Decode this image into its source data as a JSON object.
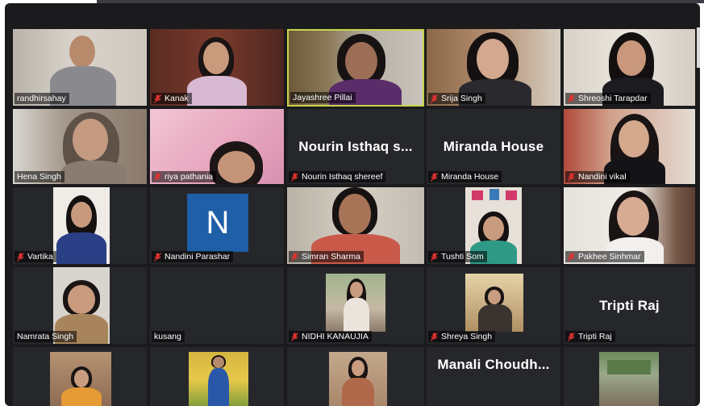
{
  "meeting": {
    "participants": [
      {
        "name": "randhirsahay",
        "muted": false,
        "video": true,
        "active": false
      },
      {
        "name": "Kanak",
        "muted": true,
        "video": true,
        "active": false
      },
      {
        "name": "Jayashree Pillai",
        "muted": false,
        "video": true,
        "active": true
      },
      {
        "name": "Srija Singh",
        "muted": true,
        "video": true,
        "active": false
      },
      {
        "name": "Shreoshi Tarapdar",
        "muted": true,
        "video": true,
        "active": false
      },
      {
        "name": "Hena Singh",
        "muted": false,
        "video": true,
        "active": false
      },
      {
        "name": "riya pathania",
        "muted": true,
        "video": true,
        "active": false
      },
      {
        "name": "Nourin Isthaq shereef",
        "display_name": "Nourin Isthaq s...",
        "muted": true,
        "video": false,
        "active": false
      },
      {
        "name": "Miranda House",
        "display_name": "Miranda House",
        "muted": true,
        "video": false,
        "active": false
      },
      {
        "name": "Nandini vikal",
        "muted": true,
        "video": true,
        "active": false
      },
      {
        "name": "Vartika",
        "muted": true,
        "video": true,
        "active": false
      },
      {
        "name": "Nandini Parashar",
        "avatar_letter": "N",
        "muted": true,
        "video": false,
        "active": false
      },
      {
        "name": "Simran Sharma",
        "muted": true,
        "video": true,
        "active": false
      },
      {
        "name": "Tushti Som",
        "muted": true,
        "video": true,
        "active": false
      },
      {
        "name": "Pakhee Sinhmar",
        "muted": true,
        "video": true,
        "active": false
      },
      {
        "name": "Namrata Singh",
        "muted": false,
        "video": true,
        "active": false
      },
      {
        "name": "kusang",
        "muted": false,
        "video": false,
        "active": false
      },
      {
        "name": "NIDHI KANAUJIA",
        "muted": true,
        "video": true,
        "active": false
      },
      {
        "name": "Shreya Singh",
        "muted": true,
        "video": true,
        "active": false
      },
      {
        "name": "Tripti Raj",
        "display_name": "Tripti Raj",
        "muted": true,
        "video": false,
        "active": false
      },
      {
        "name": "",
        "muted": false,
        "video": true,
        "active": false
      },
      {
        "name": "",
        "muted": false,
        "video": true,
        "active": false
      },
      {
        "name": "",
        "muted": false,
        "video": true,
        "active": false
      },
      {
        "name": "Manali Choudhary",
        "display_name": "Manali Choudh...",
        "muted": false,
        "video": false,
        "active": false
      },
      {
        "name": "",
        "muted": false,
        "video": true,
        "active": false
      }
    ],
    "colors": {
      "background": "#1b1b1d",
      "tile": "#26272b",
      "active_border": "#c7d64a",
      "muted_icon": "#e0322f",
      "avatar": "#1f5fa8"
    }
  }
}
